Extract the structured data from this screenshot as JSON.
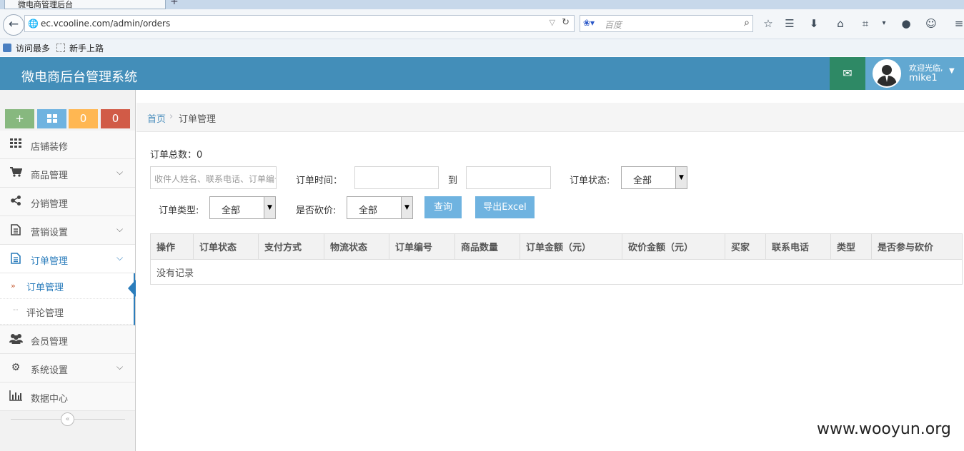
{
  "browser": {
    "tab_title": "微电商管理后台",
    "url": "ec.vcooline.com/admin/orders",
    "search_placeholder": "百度",
    "bookmarks": [
      "访问最多",
      "新手上路"
    ]
  },
  "header": {
    "title": "微电商后台管理系统",
    "welcome": "欢迎光临,",
    "username": "mike1"
  },
  "sidebar": {
    "shortcuts": [
      {
        "label": "+",
        "color": "#87b87f"
      },
      {
        "label": "",
        "color": "#6fb3e0"
      },
      {
        "label": "0",
        "color": "#ffb752"
      },
      {
        "label": "0",
        "color": "#d15b47"
      }
    ],
    "items": [
      {
        "label": "店铺装修",
        "icon": "grid-icon"
      },
      {
        "label": "商品管理",
        "icon": "cart-icon"
      },
      {
        "label": "分销管理",
        "icon": "share-icon"
      },
      {
        "label": "营销设置",
        "icon": "document-icon"
      },
      {
        "label": "订单管理",
        "icon": "document-icon"
      },
      {
        "label": "会员管理",
        "icon": "users-icon"
      },
      {
        "label": "系统设置",
        "icon": "gear-icon"
      },
      {
        "label": "数据中心",
        "icon": "bar-chart-icon"
      }
    ],
    "sub_items": [
      "订单管理",
      "评论管理"
    ]
  },
  "breadcrumb": {
    "home": "首页",
    "current": "订单管理"
  },
  "filters": {
    "total_label": "订单总数：0",
    "keyword_placeholder": "收件人姓名、联系电话、订单编号",
    "time_label": "订单时间：",
    "to_label": "到",
    "status_label": "订单状态:",
    "status_value": "全部",
    "type_label": "订单类型:",
    "type_value": "全部",
    "bargain_label": "是否砍价:",
    "bargain_value": "全部",
    "query_button": "查询",
    "export_button": "导出Excel"
  },
  "table": {
    "columns": [
      "操作",
      "订单状态",
      "支付方式",
      "物流状态",
      "订单编号",
      "商品数量",
      "订单金额（元）",
      "砍价金额（元）",
      "买家",
      "联系电话",
      "类型",
      "是否参与砍价"
    ],
    "empty_text": "没有记录"
  },
  "watermark": "www.wooyun.org"
}
